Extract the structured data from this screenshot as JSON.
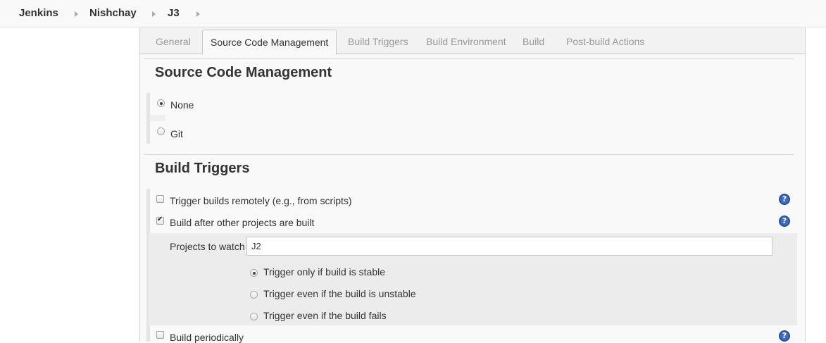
{
  "breadcrumb": {
    "items": [
      "Jenkins",
      "Nishchay",
      "J3"
    ]
  },
  "tabs": [
    "General",
    "Source Code Management",
    "Build Triggers",
    "Build Environment",
    "Build",
    "Post-build Actions"
  ],
  "active_tab": "Source Code Management",
  "scm": {
    "title": "Source Code Management",
    "options": [
      {
        "label": "None",
        "selected": true
      },
      {
        "label": "Git",
        "selected": false
      }
    ]
  },
  "triggers": {
    "title": "Build Triggers",
    "trigger_remotely": {
      "label": "Trigger builds remotely (e.g., from scripts)",
      "checked": false
    },
    "build_after_other": {
      "label": "Build after other projects are built",
      "checked": true
    },
    "projects_to_watch": {
      "label": "Projects to watch",
      "value": "J2"
    },
    "threshold_options": [
      {
        "label": "Trigger only if build is stable",
        "selected": true
      },
      {
        "label": "Trigger even if the build is unstable",
        "selected": false
      },
      {
        "label": "Trigger even if the build fails",
        "selected": false
      }
    ],
    "build_periodically": {
      "label": "Build periodically",
      "checked": false
    }
  },
  "help_glyph": "?",
  "icons": {
    "help": "help-circle-icon",
    "separator": "chevron-right-icon"
  },
  "colors": {
    "help_blue": "#3d6cc0",
    "panel_bg": "#f9f9f9"
  }
}
